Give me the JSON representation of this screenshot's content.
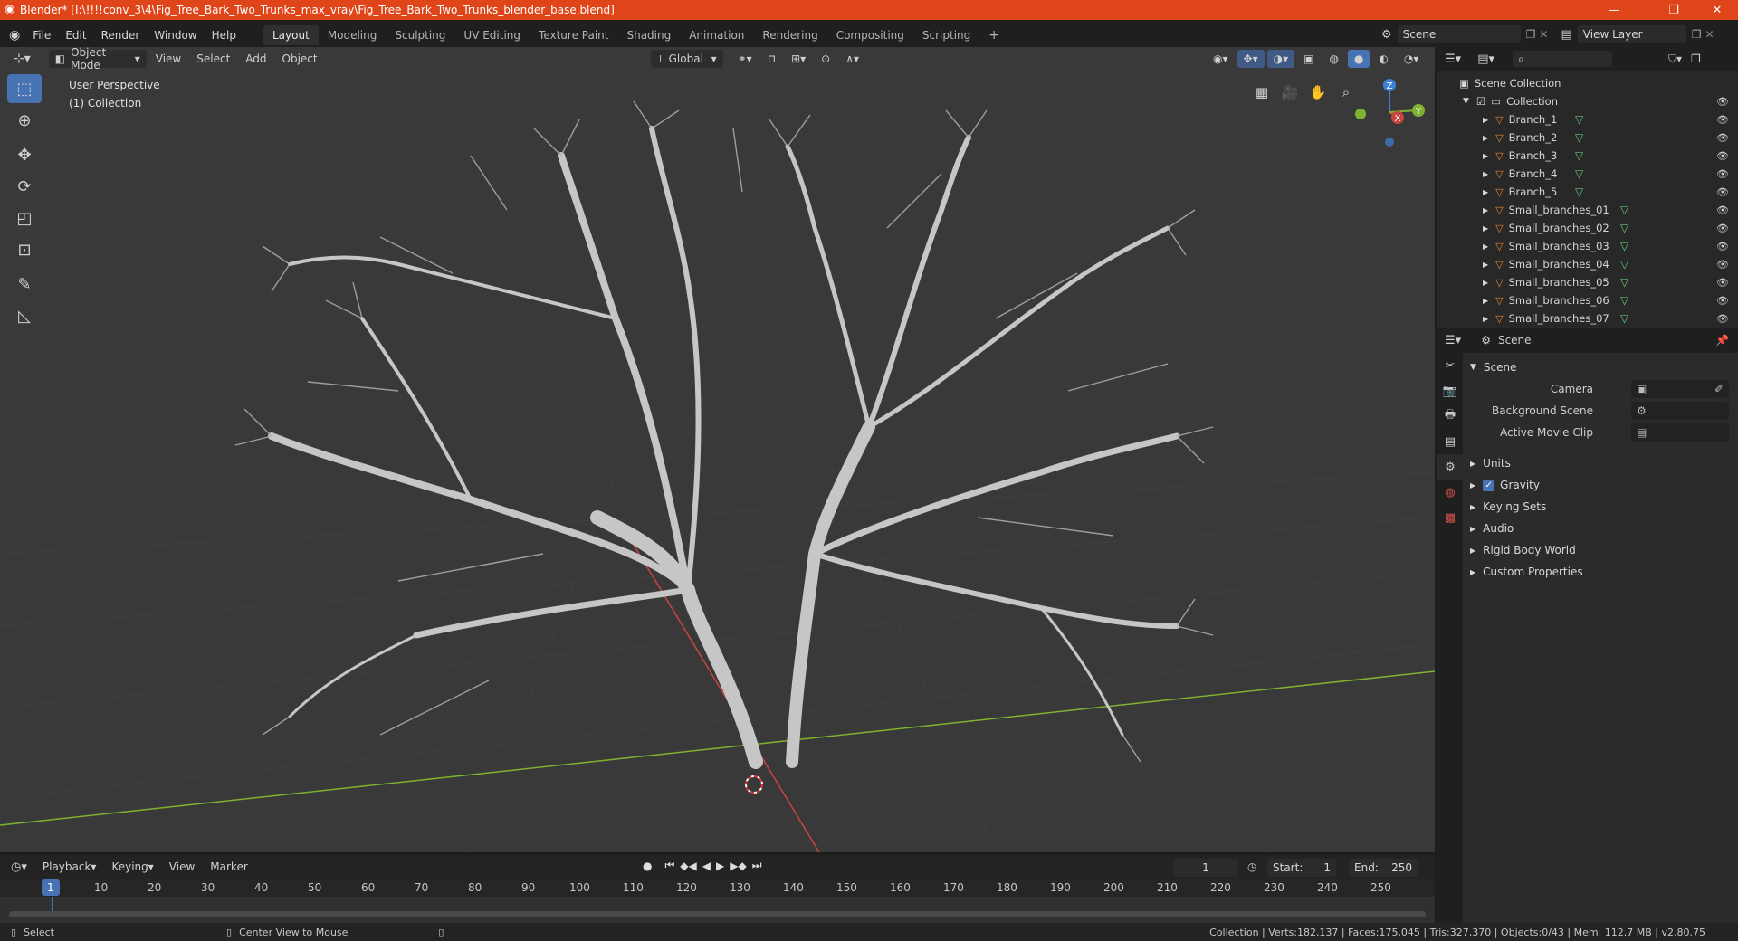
{
  "window": {
    "title": "Blender* [I:\\!!!!conv_3\\4\\Fig_Tree_Bark_Two_Trunks_max_vray\\Fig_Tree_Bark_Two_Trunks_blender_base.blend]",
    "minimize": "—",
    "maximize": "❐",
    "close": "✕"
  },
  "menus": [
    "File",
    "Edit",
    "Render",
    "Window",
    "Help"
  ],
  "workspaces": [
    "Layout",
    "Modeling",
    "Sculpting",
    "UV Editing",
    "Texture Paint",
    "Shading",
    "Animation",
    "Rendering",
    "Compositing",
    "Scripting"
  ],
  "add_workspace": "+",
  "scene_field": "Scene",
  "view_layer_field": "View Layer",
  "viewport_header": {
    "mode": "Object Mode",
    "menus": [
      "View",
      "Select",
      "Add",
      "Object"
    ],
    "transform_orientation": "Global"
  },
  "viewport": {
    "perspective": "User Perspective",
    "collection": "(1) Collection",
    "gizmo_labels": {
      "z": "Z",
      "x": "X",
      "y": "Y"
    }
  },
  "outliner": {
    "scene_collection": "Scene Collection",
    "collection": "Collection",
    "items": [
      "Branch_1",
      "Branch_2",
      "Branch_3",
      "Branch_4",
      "Branch_5",
      "Small_branches_01",
      "Small_branches_02",
      "Small_branches_03",
      "Small_branches_04",
      "Small_branches_05",
      "Small_branches_06",
      "Small_branches_07"
    ]
  },
  "properties": {
    "context": "Scene",
    "panel": "Scene",
    "fields": [
      {
        "label": "Camera"
      },
      {
        "label": "Background Scene"
      },
      {
        "label": "Active Movie Clip"
      }
    ],
    "sections": [
      "Units",
      "Gravity",
      "Keying Sets",
      "Audio",
      "Rigid Body World",
      "Custom Properties"
    ],
    "gravity_checked": true
  },
  "timeline": {
    "menus": [
      "Playback",
      "Keying",
      "View",
      "Marker"
    ],
    "current_frame": "1",
    "start_label": "Start:",
    "start": "1",
    "end_label": "End:",
    "end": "250",
    "ruler": [
      "1",
      "10",
      "20",
      "30",
      "40",
      "50",
      "60",
      "70",
      "80",
      "90",
      "100",
      "110",
      "120",
      "130",
      "140",
      "150",
      "160",
      "170",
      "180",
      "190",
      "200",
      "210",
      "220",
      "230",
      "240",
      "250"
    ]
  },
  "statusbar": {
    "select": "Select",
    "center_view": "Center View to Mouse",
    "stats": "Collection | Verts:182,137 | Faces:175,045 | Tris:327,370 | Objects:0/43 | Mem: 112.7 MB | v2.80.75"
  },
  "colors": {
    "titlebar": "#e0451a",
    "active_tool": "#4772b3",
    "mesh_icon": "#e8842c",
    "vertex_group_icon": "#67c77b",
    "x_axis": "#c9453f",
    "y_axis": "#7fb230",
    "z_axis": "#3f7fd8"
  }
}
